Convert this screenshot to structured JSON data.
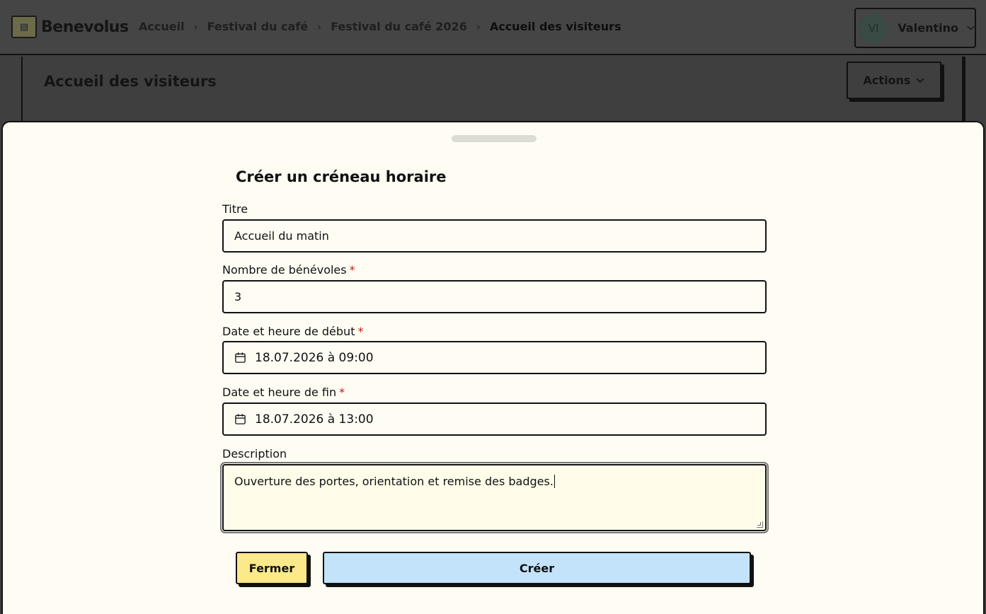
{
  "app": {
    "name": "Benevolus",
    "breadcrumb": [
      "Accueil",
      "Festival du café",
      "Festival du café 2026",
      "Accueil des visiteurs"
    ],
    "user": {
      "initials": "VI",
      "name": "Valentino"
    }
  },
  "page": {
    "title": "Accueil des visiteurs",
    "actions_label": "Actions"
  },
  "modal": {
    "title": "Créer un créneau horaire",
    "fields": {
      "title": {
        "label": "Titre",
        "value": "Accueil du matin"
      },
      "volunteers": {
        "label": "Nombre de bénévoles",
        "required_mark": "*",
        "value": "3"
      },
      "start": {
        "label": "Date et heure de début",
        "required_mark": "*",
        "value": "18.07.2026 à 09:00"
      },
      "end": {
        "label": "Date et heure de fin",
        "required_mark": "*",
        "value": "18.07.2026 à 13:00"
      },
      "description": {
        "label": "Description",
        "value": "Ouverture des portes, orientation et remise des badges."
      }
    },
    "close_label": "Fermer",
    "create_label": "Créer"
  },
  "colors": {
    "accent_yellow": "#fce98a",
    "accent_blue": "#c3e3fa",
    "required": "#c4191b",
    "sheet_bg": "#fffdf3"
  }
}
